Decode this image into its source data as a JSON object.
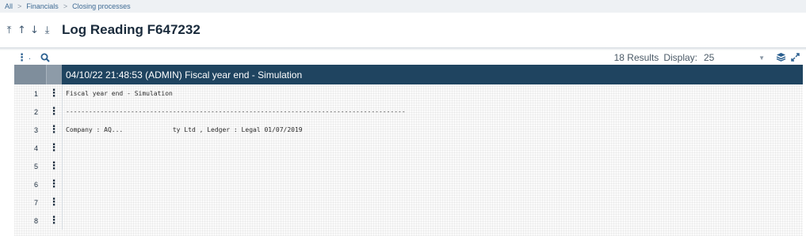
{
  "breadcrumb": [
    "All",
    "Financials",
    "Closing processes"
  ],
  "title": "Log Reading F647232",
  "nav_arrows": [
    "⤒",
    "↑",
    "↓",
    "⤓"
  ],
  "toolbar": {
    "menu_icon": "vertical-dots-icon",
    "search_icon": "search-icon",
    "results_text": "18 Results",
    "display_label": "Display:",
    "display_value": "25",
    "layers_icon": "layers-icon",
    "expand_icon": "expand-icon"
  },
  "grid": {
    "header": "04/10/22 21:48:53 (ADMIN) Fiscal year end - Simulation",
    "rows": [
      {
        "num": "1",
        "text": "Fiscal year end - Simulation"
      },
      {
        "num": "2",
        "text": "-----------------------------------------------------------------------------------------"
      },
      {
        "num": "3",
        "text": "Company : AQ...             ty Ltd , Ledger : Legal 01/07/2019"
      },
      {
        "num": "4",
        "text": ""
      },
      {
        "num": "5",
        "text": ""
      },
      {
        "num": "6",
        "text": ""
      },
      {
        "num": "7",
        "text": ""
      },
      {
        "num": "8",
        "text": ""
      }
    ]
  },
  "colors": {
    "header_bg": "#1f4460",
    "link": "#3f6b94",
    "icon": "#2a5f8f"
  }
}
